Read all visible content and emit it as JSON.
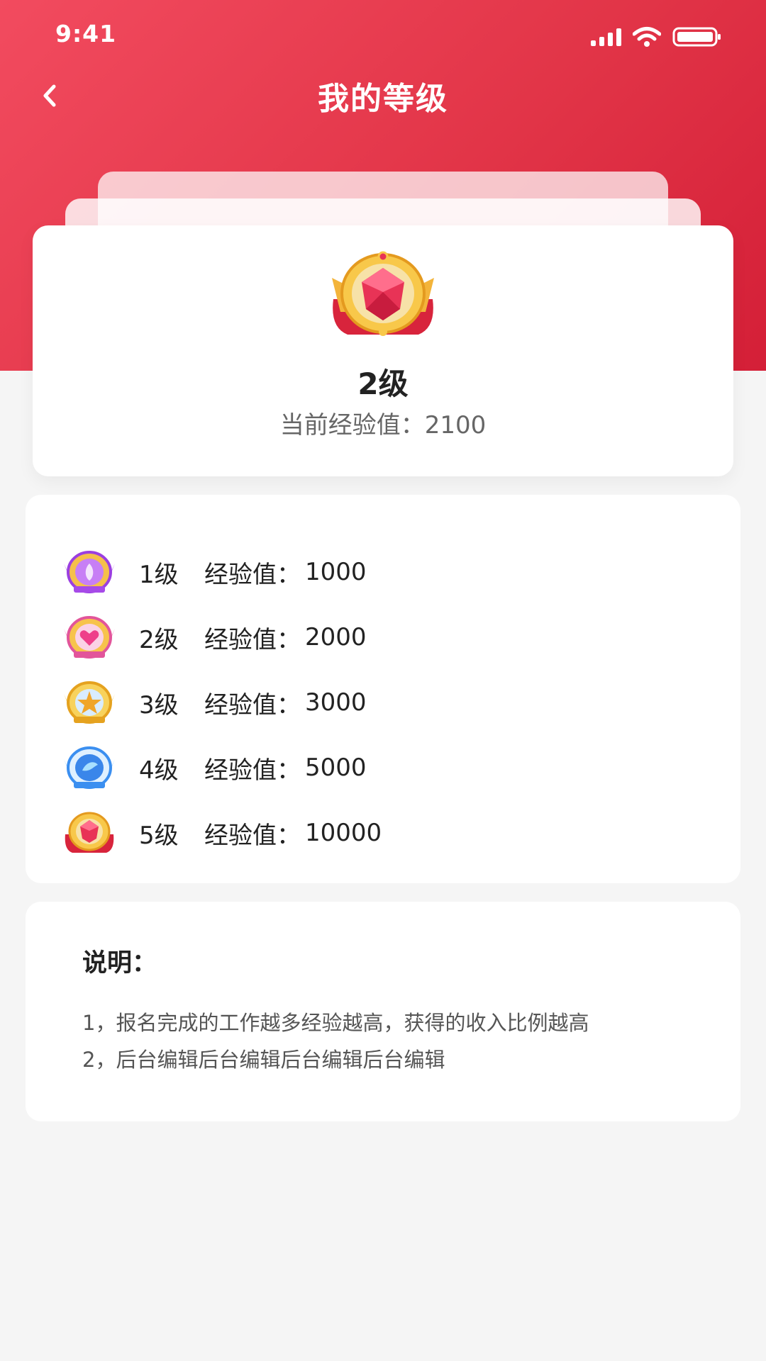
{
  "status_bar": {
    "time": "9:41"
  },
  "header": {
    "title": "我的等级"
  },
  "current": {
    "level": "2级",
    "exp_label": "当前经验值：",
    "exp_value": "2100"
  },
  "levels": [
    {
      "level": "1级",
      "exp_label": "经验值：",
      "exp_value": "1000",
      "badge": "purple-badge-icon"
    },
    {
      "level": "2级",
      "exp_label": "经验值：",
      "exp_value": "2000",
      "badge": "pink-heart-badge-icon"
    },
    {
      "level": "3级",
      "exp_label": "经验值：",
      "exp_value": "3000",
      "badge": "gold-star-badge-icon"
    },
    {
      "level": "4级",
      "exp_label": "经验值：",
      "exp_value": "5000",
      "badge": "blue-crystal-badge-icon"
    },
    {
      "level": "5级",
      "exp_label": "经验值：",
      "exp_value": "10000",
      "badge": "red-gem-badge-icon"
    }
  ],
  "description": {
    "title": "说明：",
    "lines": [
      "1，报名完成的工作越多经验越高，获得的收入比例越高",
      "2，后台编辑后台编辑后台编辑后台编辑"
    ]
  },
  "colors": {
    "header_start": "#f24b5f",
    "header_end": "#d41f37",
    "background": "#f5f5f5"
  }
}
